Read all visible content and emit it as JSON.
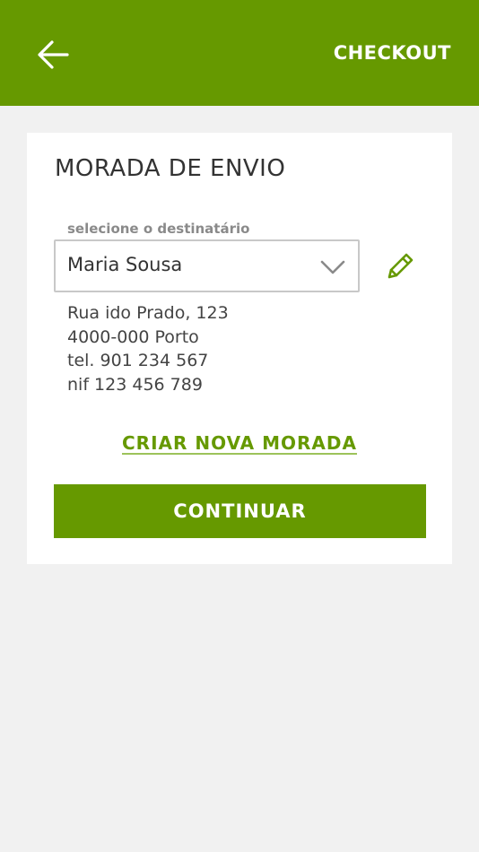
{
  "header": {
    "back_icon": "arrow-left-icon",
    "title": "CHECKOUT"
  },
  "shipping": {
    "title": "MORADA DE ENVIO",
    "recipient_label": "selecione o destinatário",
    "recipient_selected": "Maria Sousa",
    "dropdown_icon": "chevron-down-icon",
    "edit_icon": "pencil-icon",
    "address_lines": [
      "Rua ido Prado, 123",
      "4000-000 Porto",
      "tel. 901 234 567",
      "nif 123 456 789"
    ],
    "new_address_link": "CRIAR NOVA MORADA",
    "continue_label": "CONTINUAR"
  },
  "colors": {
    "brand_green": "#669900",
    "background": "#f1f1f1",
    "card": "#ffffff"
  }
}
